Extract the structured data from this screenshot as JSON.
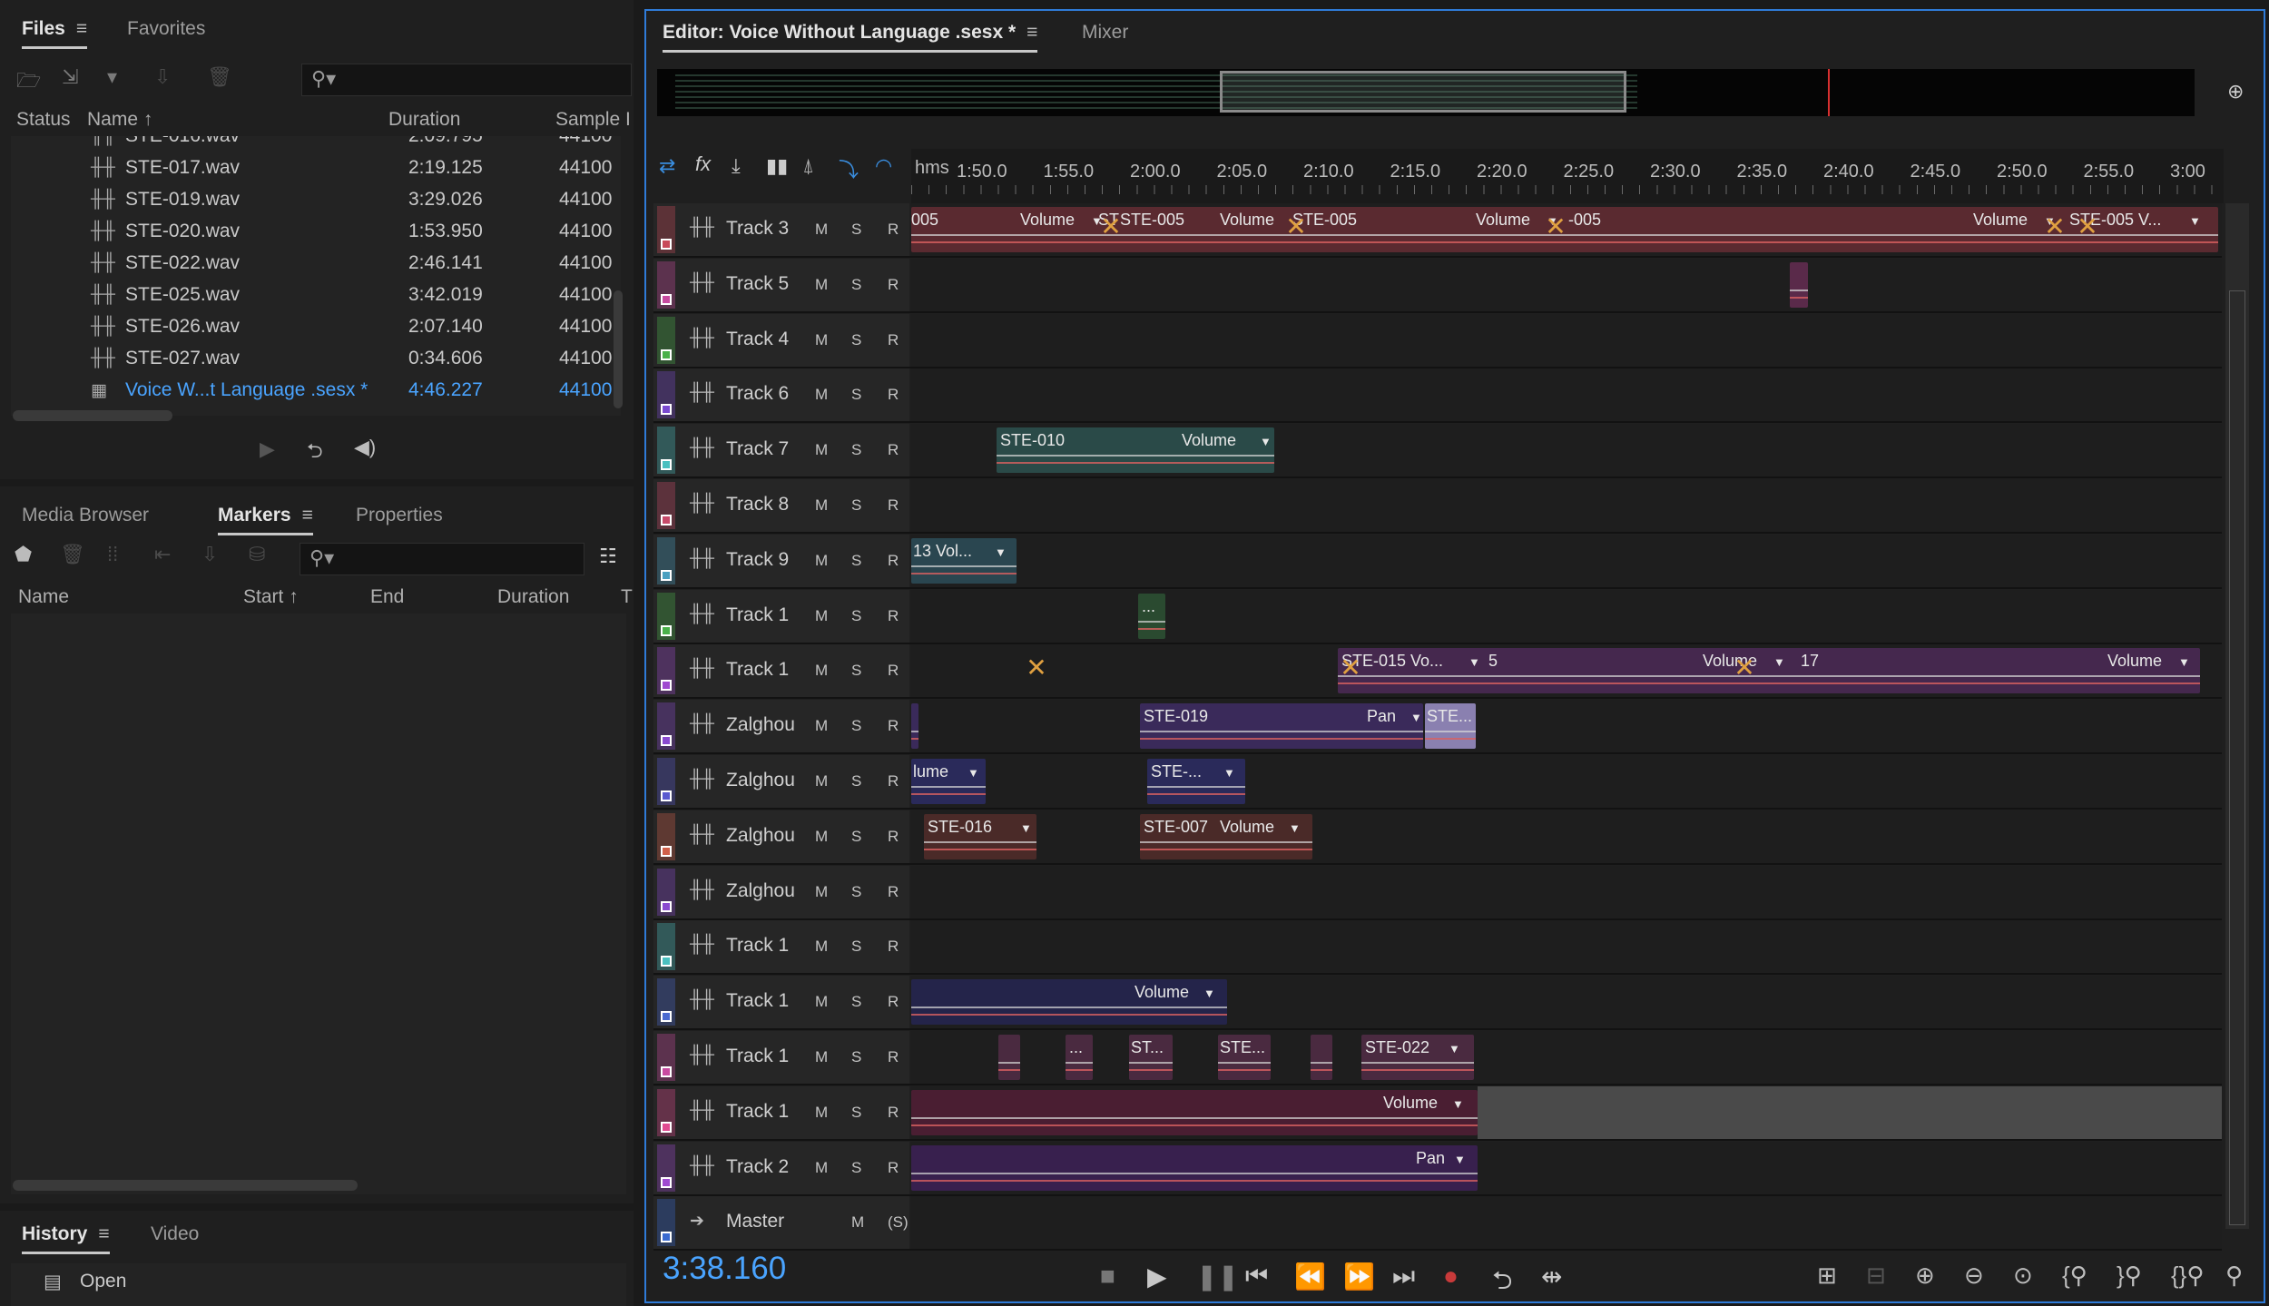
{
  "files_panel": {
    "tabs": [
      {
        "label": "Files"
      },
      {
        "label": "Favorites"
      }
    ],
    "columns": {
      "status": "Status",
      "name": "Name",
      "duration": "Duration",
      "sample": "Sample I"
    },
    "rows": [
      {
        "name": "STE-016.wav",
        "duration": "2:09.795",
        "sample": "44100"
      },
      {
        "name": "STE-017.wav",
        "duration": "2:19.125",
        "sample": "44100"
      },
      {
        "name": "STE-019.wav",
        "duration": "3:29.026",
        "sample": "44100"
      },
      {
        "name": "STE-020.wav",
        "duration": "1:53.950",
        "sample": "44100"
      },
      {
        "name": "STE-022.wav",
        "duration": "2:46.141",
        "sample": "44100"
      },
      {
        "name": "STE-025.wav",
        "duration": "3:42.019",
        "sample": "44100"
      },
      {
        "name": "STE-026.wav",
        "duration": "2:07.140",
        "sample": "44100"
      },
      {
        "name": "STE-027.wav",
        "duration": "0:34.606",
        "sample": "44100"
      },
      {
        "name": "Voice W...t Language .sesx *",
        "duration": "4:46.227",
        "sample": "44100",
        "selected": true
      }
    ]
  },
  "markers_panel": {
    "tabs": [
      {
        "label": "Media Browser"
      },
      {
        "label": "Markers"
      },
      {
        "label": "Properties"
      }
    ],
    "columns": {
      "name": "Name",
      "start": "Start",
      "end": "End",
      "duration": "Duration",
      "type": "T"
    }
  },
  "history_panel": {
    "tabs": [
      {
        "label": "History"
      },
      {
        "label": "Video"
      }
    ],
    "items": [
      {
        "label": "Open"
      }
    ]
  },
  "editor": {
    "tab_label": "Editor: Voice Without Language .sesx *",
    "mixer_label": "Mixer",
    "ruler": {
      "unit": "hms",
      "ticks": [
        "1:50.0",
        "1:55.0",
        "2:00.0",
        "2:05.0",
        "2:10.0",
        "2:15.0",
        "2:20.0",
        "2:25.0",
        "2:30.0",
        "2:35.0",
        "2:40.0",
        "2:45.0",
        "2:50.0",
        "2:55.0",
        "3:00"
      ]
    },
    "current_time": "3:38.160",
    "tracks": [
      {
        "name": "Track 3",
        "color": "#c84a5a",
        "rec": "R"
      },
      {
        "name": "Track 5",
        "color": "#c84aa0",
        "rec": "R"
      },
      {
        "name": "Track 4",
        "color": "#4ab04a",
        "rec": "R"
      },
      {
        "name": "Track 6",
        "color": "#7a4ad0",
        "rec": "R"
      },
      {
        "name": "Track 7",
        "color": "#4ac0c0",
        "rec": "R"
      },
      {
        "name": "Track 8",
        "color": "#c84a6a",
        "rec": "R"
      },
      {
        "name": "Track 9",
        "color": "#4aa0c0",
        "rec": "R"
      },
      {
        "name": "Track 1",
        "color": "#4ab04a",
        "rec": "R"
      },
      {
        "name": "Track 1",
        "color": "#a04ad0",
        "rec": "R"
      },
      {
        "name": "Zalghou",
        "color": "#8a4ad0",
        "rec": "R"
      },
      {
        "name": "Zalghou",
        "color": "#5a5ad0",
        "rec": "R"
      },
      {
        "name": "Zalghou",
        "color": "#d0604a",
        "rec": "R"
      },
      {
        "name": "Zalghou",
        "color": "#8a4ad0",
        "rec": "R"
      },
      {
        "name": "Track 1",
        "color": "#4ac0c0",
        "rec": "R"
      },
      {
        "name": "Track 1",
        "color": "#4a6ad0",
        "rec": "R"
      },
      {
        "name": "Track 1",
        "color": "#c84aa0",
        "rec": "R"
      },
      {
        "name": "Track 1",
        "color": "#e04a90",
        "rec": "R"
      },
      {
        "name": "Track 2",
        "color": "#a04ad0",
        "rec": "R"
      },
      {
        "name": "Master",
        "color": "#3a6ad0",
        "rec": "",
        "master": true
      }
    ],
    "buttons": {
      "mute": "M",
      "solo": "S",
      "master_solo": "(S)"
    },
    "clips": {
      "t3": [
        "005",
        "Volume",
        "ST",
        "STE-005",
        "Volume",
        "STE-005",
        "Volume",
        "-005",
        "Volume",
        "STE-005 V..."
      ],
      "t7": [
        "STE-010",
        "Volume"
      ],
      "t9": [
        "13 Vol..."
      ],
      "t1a": [
        "..."
      ],
      "t1b": [
        "STE-015 Vo...",
        "5",
        "Volume",
        "17",
        "Volume"
      ],
      "z1": [
        "STE-019",
        "Pan",
        "STE..."
      ],
      "z2": [
        "lume",
        "STE-..."
      ],
      "z3": [
        "STE-016",
        "STE-007",
        "Volume"
      ],
      "t1c": [
        "Volume"
      ],
      "t1d": [
        "...",
        "ST...",
        "STE...",
        "STE-022"
      ],
      "t1e": [
        "Volume"
      ],
      "t2": [
        "Pan"
      ]
    }
  }
}
